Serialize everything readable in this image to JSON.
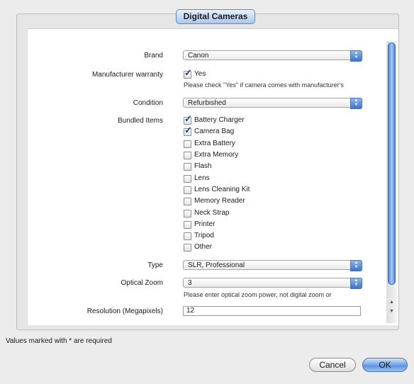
{
  "dialog": {
    "group_title": "Digital Cameras",
    "footer_note": "Values marked with * are required",
    "cancel_label": "Cancel",
    "ok_label": "OK"
  },
  "form": {
    "brand": {
      "label": "Brand",
      "value": "Canon"
    },
    "warranty": {
      "label": "Manufacturer warranty",
      "option": "Yes",
      "checked": true,
      "hint": "Please check \"Yes\" if camera comes with manufacturer's"
    },
    "condition": {
      "label": "Condition",
      "value": "Refurbished"
    },
    "bundled": {
      "label": "Bundled Items",
      "items": [
        {
          "label": "Battery Charger",
          "checked": true
        },
        {
          "label": "Camera Bag",
          "checked": true
        },
        {
          "label": "Extra Battery",
          "checked": false
        },
        {
          "label": "Extra Memory",
          "checked": false
        },
        {
          "label": "Flash",
          "checked": false
        },
        {
          "label": "Lens",
          "checked": false
        },
        {
          "label": "Lens Cleaning Kit",
          "checked": false
        },
        {
          "label": "Memory Reader",
          "checked": false
        },
        {
          "label": "Neck Strap",
          "checked": false
        },
        {
          "label": "Printer",
          "checked": false
        },
        {
          "label": "Tripod",
          "checked": false
        },
        {
          "label": "Other",
          "checked": false
        }
      ]
    },
    "type": {
      "label": "Type",
      "value": "SLR, Professional"
    },
    "optical_zoom": {
      "label": "Optical Zoom",
      "value": "3",
      "hint": "Please enter optical zoom power, not digital zoom or"
    },
    "resolution": {
      "label": "Resolution (Megapixels)",
      "value": "12"
    }
  },
  "icons": {
    "check": "checkmark-icon",
    "select_arrows": "up-down-arrows-icon",
    "scroll_up": "scroll-up-arrow-icon",
    "scroll_down": "scroll-down-arrow-icon"
  },
  "colors": {
    "accent": "#5f96e0",
    "scroll_thumb": "#4f86d8"
  }
}
